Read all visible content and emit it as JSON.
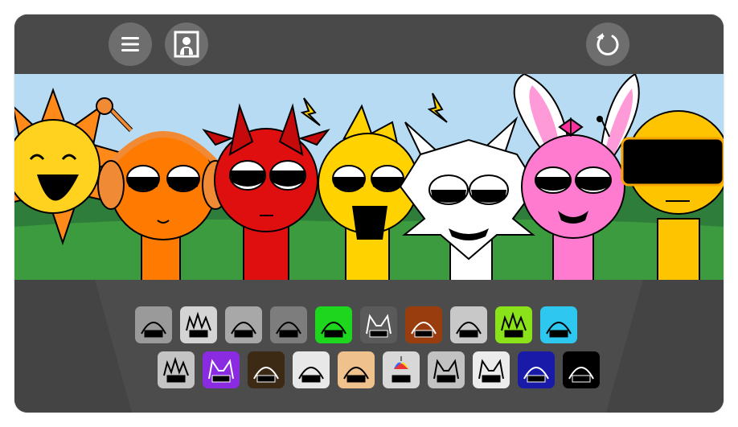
{
  "topbar": {
    "menu_button": {
      "icon": "hamburger-menu-icon"
    },
    "portrait_button": {
      "icon": "portrait-frame-icon"
    },
    "reset_button": {
      "icon": "restart-arrow-icon"
    }
  },
  "scene": {
    "characters": [
      {
        "name": "sun-character",
        "color": "#FFD400"
      },
      {
        "name": "orange-headphones-character",
        "color": "#FF7A00"
      },
      {
        "name": "red-horned-character",
        "color": "#E00F0F"
      },
      {
        "name": "yellow-spiky-character",
        "color": "#FFD200"
      },
      {
        "name": "white-cat-character",
        "color": "#FFFFFF"
      },
      {
        "name": "pink-bunny-character",
        "color": "#FF7BD0"
      },
      {
        "name": "yellow-visor-character",
        "color": "#FFC400"
      }
    ]
  },
  "palette": {
    "row1": [
      {
        "name": "antenna-goggles-sound-icon",
        "bg": "#9a9a9a"
      },
      {
        "name": "spiky-hair-sound-icon",
        "bg": "#d4d4d4"
      },
      {
        "name": "saucer-hat-sound-icon",
        "bg": "#a8a8a8"
      },
      {
        "name": "headphones-sound-icon",
        "bg": "#7d7d7d"
      },
      {
        "name": "green-fruit-sound-icon",
        "bg": "#1ed61e"
      },
      {
        "name": "gray-ears-sound-icon",
        "bg": "#5a5a5a"
      },
      {
        "name": "brown-bucket-sound-icon",
        "bg": "#9a3d0e"
      },
      {
        "name": "white-helmet-sound-icon",
        "bg": "#c8c8c8"
      },
      {
        "name": "lime-spikes-sound-icon",
        "bg": "#8ae21a"
      },
      {
        "name": "cyan-earmuffs-sound-icon",
        "bg": "#2ec7f0"
      }
    ],
    "row2": [
      {
        "name": "star-burst-sound-icon",
        "bg": "#c4c4c4"
      },
      {
        "name": "purple-horns-sound-icon",
        "bg": "#8a2be2"
      },
      {
        "name": "olive-leaf-sound-icon",
        "bg": "#3d2a14"
      },
      {
        "name": "scribble-hair-sound-icon",
        "bg": "#e8e8e8"
      },
      {
        "name": "brown-hair-sound-icon",
        "bg": "#efc28d"
      },
      {
        "name": "propeller-cap-sound-icon",
        "bg": "#d8d8d8"
      },
      {
        "name": "cat-ears-sound-icon",
        "bg": "#c2c2c2"
      },
      {
        "name": "bunny-ears-sound-icon",
        "bg": "#ececec"
      },
      {
        "name": "navy-dome-sound-icon",
        "bg": "#1a1aa8"
      },
      {
        "name": "black-visor-sound-icon",
        "bg": "#000000"
      }
    ]
  }
}
